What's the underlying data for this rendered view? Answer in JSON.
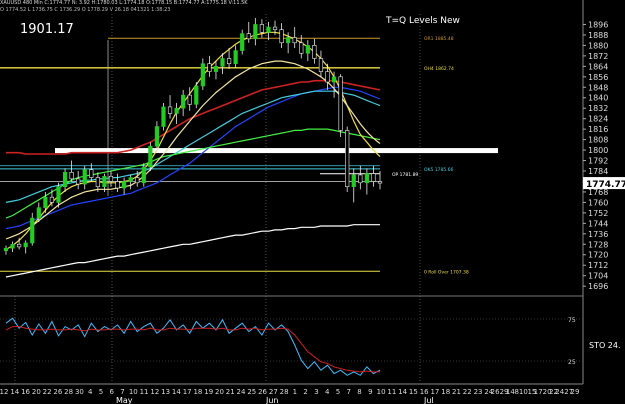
{
  "header": {
    "line1": "XAUUSD 480 Min  C:1774.77  N: 3.92  H:1780.03  L:1774.18  O:1778.15  B:1774.77  A:1775.18  V:11.5K",
    "line2": "O 1774.52  L 1736.75  C 1736.29  O 1778.29  V 26.18  041321  1:38:23"
  },
  "price_label": "1901.17",
  "study_title": "T=Q Levels New",
  "colors": {
    "background": "#000000",
    "candle": "#22cc22",
    "red_line": "#cc2222",
    "blue_line": "#2244ff",
    "cyan_line": "#44ccdd",
    "yellow_line": "#eedd44",
    "green_line": "#44ee44",
    "white_line": "#ffffff"
  },
  "chart_data": [
    {
      "type": "candlestick",
      "y_ticks": [
        1896,
        1888,
        1880,
        1872,
        1864,
        1856,
        1848,
        1840,
        1832,
        1824,
        1816,
        1808,
        1800,
        1792,
        1784,
        1768,
        1760,
        1752,
        1744,
        1736,
        1728,
        1720,
        1712,
        1704,
        1696
      ],
      "ylim": [
        1690,
        1904
      ],
      "last_price": "1774.77",
      "x_ticks": [
        "12",
        "14",
        "16",
        "20",
        "22",
        "26",
        "28",
        "30",
        "4",
        "5",
        "6",
        "7",
        "10",
        "11",
        "12",
        "13",
        "14",
        "17",
        "18",
        "19",
        "20",
        "21",
        "24",
        "25",
        "26",
        "27",
        "28",
        "1",
        "2",
        "3",
        "4",
        "5",
        "7",
        "8",
        "9",
        "10",
        "11",
        "14",
        "15",
        "16",
        "17",
        "18",
        "21",
        "22",
        "23",
        "24",
        "2629",
        "14",
        "810",
        "15",
        "1720",
        "22",
        "2427",
        "29"
      ],
      "month_labels": [
        "May",
        "Jun",
        "Jul"
      ],
      "levels": [
        {
          "label": "OR1 1885.48",
          "value": 1885.48,
          "color": "#cc9933"
        },
        {
          "label": "OH4 1862.74",
          "value": 1862.74,
          "color": "#eedd44"
        },
        {
          "label": "OK5 1785.66",
          "value": 1785.66,
          "color": "#44ccdd"
        },
        {
          "label": "OP 1781.89",
          "value": 1781.89,
          "color": "#ffffff"
        },
        {
          "label": "0 Roll Over 1707.38",
          "value": 1707.38,
          "color": "#eedd44"
        }
      ],
      "candles": [
        [
          1723,
          1727,
          1720,
          1725
        ],
        [
          1725,
          1730,
          1722,
          1728
        ],
        [
          1728,
          1733,
          1724,
          1726
        ],
        [
          1726,
          1731,
          1721,
          1729
        ],
        [
          1729,
          1752,
          1727,
          1748
        ],
        [
          1748,
          1760,
          1745,
          1756
        ],
        [
          1756,
          1768,
          1752,
          1764
        ],
        [
          1764,
          1770,
          1757,
          1760
        ],
        [
          1760,
          1775,
          1756,
          1772
        ],
        [
          1772,
          1786,
          1768,
          1783
        ],
        [
          1783,
          1792,
          1776,
          1778
        ],
        [
          1778,
          1784,
          1770,
          1774
        ],
        [
          1774,
          1788,
          1770,
          1785
        ],
        [
          1785,
          1790,
          1776,
          1779
        ],
        [
          1779,
          1783,
          1768,
          1772
        ],
        [
          1772,
          1782,
          1768,
          1780
        ],
        [
          1780,
          1784,
          1772,
          1776
        ],
        [
          1776,
          1782,
          1768,
          1771
        ],
        [
          1771,
          1779,
          1766,
          1776
        ],
        [
          1776,
          1781,
          1770,
          1779
        ],
        [
          1779,
          1784,
          1772,
          1775
        ],
        [
          1775,
          1790,
          1772,
          1787
        ],
        [
          1787,
          1806,
          1784,
          1803
        ],
        [
          1803,
          1822,
          1799,
          1818
        ],
        [
          1818,
          1836,
          1815,
          1833
        ],
        [
          1833,
          1842,
          1824,
          1828
        ],
        [
          1828,
          1836,
          1820,
          1832
        ],
        [
          1832,
          1846,
          1826,
          1842
        ],
        [
          1842,
          1848,
          1830,
          1835
        ],
        [
          1835,
          1852,
          1832,
          1849
        ],
        [
          1849,
          1870,
          1846,
          1866
        ],
        [
          1866,
          1872,
          1856,
          1860
        ],
        [
          1860,
          1868,
          1854,
          1864
        ],
        [
          1864,
          1874,
          1858,
          1870
        ],
        [
          1870,
          1878,
          1862,
          1866
        ],
        [
          1866,
          1880,
          1863,
          1876
        ],
        [
          1876,
          1892,
          1873,
          1889
        ],
        [
          1889,
          1898,
          1882,
          1885
        ],
        [
          1885,
          1901,
          1880,
          1896
        ],
        [
          1896,
          1900,
          1886,
          1890
        ],
        [
          1890,
          1898,
          1884,
          1894
        ],
        [
          1894,
          1899,
          1888,
          1892
        ],
        [
          1892,
          1897,
          1878,
          1882
        ],
        [
          1882,
          1890,
          1874,
          1886
        ],
        [
          1886,
          1894,
          1878,
          1882
        ],
        [
          1882,
          1888,
          1870,
          1874
        ],
        [
          1874,
          1884,
          1868,
          1880
        ],
        [
          1880,
          1885,
          1866,
          1870
        ],
        [
          1870,
          1876,
          1856,
          1860
        ],
        [
          1860,
          1866,
          1846,
          1852
        ],
        [
          1852,
          1860,
          1840,
          1856
        ],
        [
          1856,
          1858,
          1810,
          1815
        ],
        [
          1815,
          1818,
          1768,
          1772
        ],
        [
          1772,
          1786,
          1760,
          1781
        ],
        [
          1781,
          1788,
          1770,
          1775
        ],
        [
          1775,
          1786,
          1766,
          1782
        ],
        [
          1782,
          1788,
          1772,
          1776
        ],
        [
          1776,
          1784,
          1770,
          1774.77
        ]
      ],
      "series": [
        {
          "color": "#cc2222",
          "values": [
            1798,
            1798,
            1798,
            1797,
            1797,
            1797,
            1797,
            1797,
            1797,
            1797,
            1798,
            1798,
            1798,
            1798,
            1798,
            1798,
            1798,
            1798,
            1799,
            1800,
            1802,
            1804,
            1806,
            1809,
            1812,
            1815,
            1818,
            1821,
            1824,
            1826,
            1828,
            1830,
            1832,
            1834,
            1836,
            1838,
            1840,
            1842,
            1844,
            1846,
            1847,
            1848,
            1849,
            1850,
            1851,
            1852,
            1852,
            1853,
            1853,
            1853,
            1853,
            1852,
            1851,
            1850,
            1849,
            1848,
            1847,
            1846
          ]
        },
        {
          "color": "#2244ff",
          "values": [
            1740,
            1741,
            1742,
            1744,
            1746,
            1748,
            1750,
            1752,
            1754,
            1756,
            1758,
            1759,
            1760,
            1761,
            1762,
            1763,
            1764,
            1765,
            1766,
            1767,
            1769,
            1771,
            1773,
            1775,
            1778,
            1781,
            1784,
            1787,
            1790,
            1794,
            1798,
            1802,
            1806,
            1810,
            1814,
            1818,
            1821,
            1824,
            1827,
            1830,
            1833,
            1835,
            1837,
            1839,
            1841,
            1843,
            1844,
            1845,
            1846,
            1847,
            1848,
            1848,
            1847,
            1846,
            1845,
            1843,
            1841,
            1839
          ]
        },
        {
          "color": "#44ccdd",
          "values": [
            1760,
            1761,
            1762,
            1764,
            1766,
            1768,
            1770,
            1772,
            1773,
            1774,
            1775,
            1776,
            1777,
            1777,
            1778,
            1778,
            1779,
            1779,
            1780,
            1781,
            1782,
            1784,
            1786,
            1789,
            1792,
            1795,
            1798,
            1801,
            1804,
            1807,
            1810,
            1813,
            1816,
            1819,
            1822,
            1825,
            1828,
            1830,
            1832,
            1834,
            1836,
            1838,
            1840,
            1841,
            1842,
            1843,
            1844,
            1845,
            1845,
            1845,
            1845,
            1844,
            1843,
            1842,
            1840,
            1838,
            1836,
            1834
          ]
        },
        {
          "color": "#44ee44",
          "values": [
            1748,
            1750,
            1753,
            1756,
            1759,
            1762,
            1765,
            1768,
            1771,
            1774,
            1777,
            1779,
            1780,
            1781,
            1782,
            1783,
            1784,
            1785,
            1786,
            1787,
            1788,
            1789,
            1791,
            1793,
            1795,
            1796,
            1797,
            1798,
            1799,
            1800,
            1801,
            1802,
            1803,
            1804,
            1805,
            1806,
            1807,
            1808,
            1809,
            1810,
            1811,
            1812,
            1813,
            1814,
            1815,
            1815,
            1816,
            1816,
            1816,
            1816,
            1815,
            1814,
            1813,
            1812,
            1811,
            1810,
            1809,
            1808
          ]
        },
        {
          "color": "#eedd44",
          "values": [
            1724,
            1727,
            1731,
            1736,
            1742,
            1748,
            1754,
            1760,
            1765,
            1769,
            1772,
            1774,
            1775,
            1776,
            1776,
            1775,
            1775,
            1775,
            1776,
            1777,
            1780,
            1785,
            1792,
            1800,
            1810,
            1820,
            1829,
            1836,
            1843,
            1850,
            1857,
            1863,
            1868,
            1873,
            1877,
            1881,
            1884,
            1886,
            1888,
            1889,
            1890,
            1890,
            1889,
            1887,
            1885,
            1882,
            1879,
            1875,
            1870,
            1864,
            1856,
            1846,
            1834,
            1822,
            1812,
            1806,
            1800,
            1795
          ]
        },
        {
          "color": "#f5e6a0",
          "values": [
            1732,
            1734,
            1736,
            1739,
            1742,
            1746,
            1750,
            1754,
            1758,
            1761,
            1764,
            1766,
            1768,
            1769,
            1770,
            1770,
            1770,
            1771,
            1772,
            1773,
            1776,
            1780,
            1785,
            1791,
            1797,
            1803,
            1810,
            1816,
            1822,
            1828,
            1834,
            1839,
            1844,
            1848,
            1852,
            1856,
            1859,
            1862,
            1864,
            1866,
            1867,
            1868,
            1868,
            1867,
            1866,
            1864,
            1862,
            1859,
            1856,
            1852,
            1847,
            1841,
            1834,
            1827,
            1820,
            1814,
            1809,
            1805
          ]
        },
        {
          "color": "#ffffff",
          "values": [
            1703,
            1704,
            1705,
            1706,
            1707,
            1708,
            1709,
            1710,
            1711,
            1712,
            1713,
            1714,
            1714,
            1715,
            1716,
            1717,
            1718,
            1719,
            1719,
            1720,
            1721,
            1722,
            1723,
            1724,
            1725,
            1726,
            1727,
            1728,
            1728,
            1729,
            1730,
            1731,
            1732,
            1733,
            1734,
            1735,
            1735,
            1736,
            1737,
            1738,
            1738,
            1739,
            1739,
            1740,
            1740,
            1741,
            1741,
            1741,
            1742,
            1742,
            1742,
            1742,
            1742,
            1743,
            1743,
            1743,
            1743,
            1743
          ]
        }
      ]
    },
    {
      "type": "line",
      "indicator_label": "STO 24.",
      "y_ticks": [
        75,
        25
      ],
      "ylim": [
        0,
        100
      ],
      "series": [
        {
          "color": "#44bbff",
          "values": [
            70,
            76,
            64,
            71,
            56,
            69,
            58,
            72,
            55,
            66,
            62,
            68,
            54,
            70,
            60,
            66,
            62,
            68,
            58,
            72,
            60,
            66,
            70,
            58,
            64,
            74,
            62,
            68,
            58,
            72,
            64,
            70,
            62,
            74,
            58,
            64,
            70,
            60,
            66,
            56,
            70,
            62,
            68,
            60,
            44,
            26,
            16,
            24,
            14,
            20,
            10,
            14,
            8,
            12,
            8,
            18,
            10,
            14
          ]
        },
        {
          "color": "#cc2222",
          "values": [
            62,
            66,
            66,
            64,
            63,
            62,
            62,
            63,
            62,
            62,
            63,
            62,
            61,
            63,
            62,
            62,
            63,
            63,
            62,
            63,
            63,
            62,
            64,
            62,
            62,
            64,
            63,
            63,
            62,
            64,
            64,
            64,
            63,
            64,
            62,
            62,
            64,
            63,
            64,
            62,
            63,
            63,
            64,
            63,
            56,
            46,
            36,
            30,
            24,
            22,
            18,
            16,
            14,
            13,
            12,
            13,
            12,
            12
          ]
        }
      ]
    }
  ]
}
